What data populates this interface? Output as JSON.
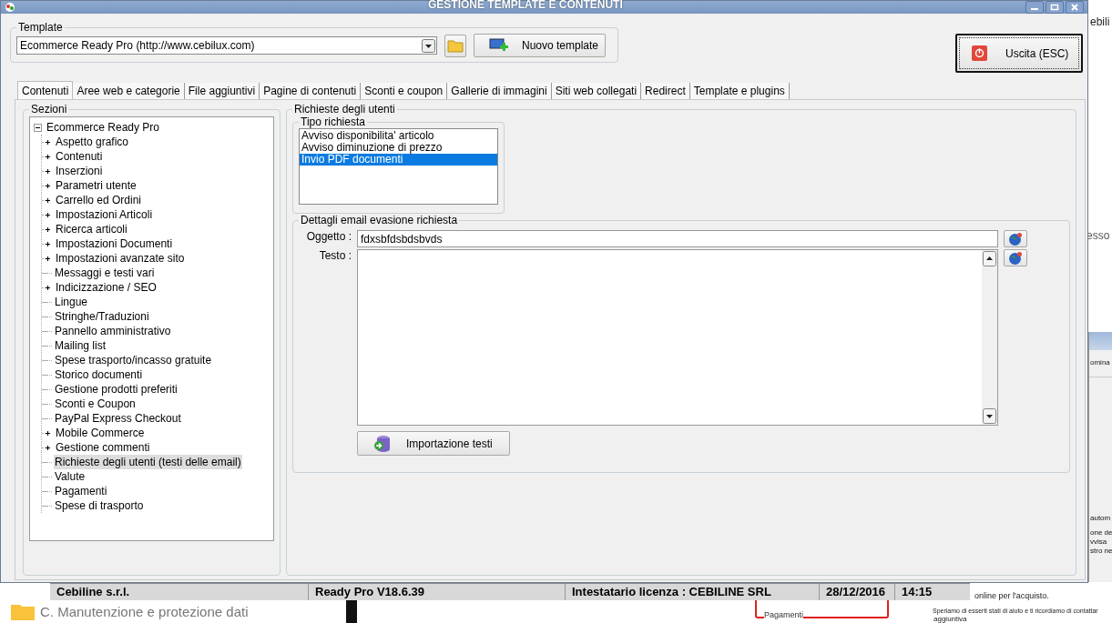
{
  "window": {
    "title": "GESTIONE TEMPLATE E CONTENUTI"
  },
  "template": {
    "label": "Template",
    "value": "Ecommerce Ready Pro (http://www.cebilux.com)",
    "new_button": "Nuovo template"
  },
  "exit_button": "Uscita (ESC)",
  "tabs": [
    {
      "label": "Contenuti",
      "selected": true
    },
    {
      "label": "Aree web e categorie",
      "selected": false
    },
    {
      "label": "File aggiuntivi",
      "selected": false
    },
    {
      "label": "Pagine di contenuti",
      "selected": false
    },
    {
      "label": "Sconti e coupon",
      "selected": false
    },
    {
      "label": "Gallerie di immagini",
      "selected": false
    },
    {
      "label": "Siti web collegati",
      "selected": false
    },
    {
      "label": "Redirect",
      "selected": false
    },
    {
      "label": "Template e plugins",
      "selected": false
    }
  ],
  "sections": {
    "label": "Sezioni",
    "tree": {
      "label": "Ecommerce Ready Pro",
      "expanded": true,
      "selected": false,
      "children": [
        {
          "label": "Aspetto grafico",
          "has_children": true,
          "selected": false
        },
        {
          "label": "Contenuti",
          "has_children": true,
          "selected": false
        },
        {
          "label": "Inserzioni",
          "has_children": true,
          "selected": false
        },
        {
          "label": "Parametri utente",
          "has_children": true,
          "selected": false
        },
        {
          "label": "Carrello ed Ordini",
          "has_children": true,
          "selected": false
        },
        {
          "label": "Impostazioni Articoli",
          "has_children": true,
          "selected": false
        },
        {
          "label": "Ricerca articoli",
          "has_children": true,
          "selected": false
        },
        {
          "label": "Impostazioni Documenti",
          "has_children": true,
          "selected": false
        },
        {
          "label": "Impostazioni avanzate sito",
          "has_children": true,
          "selected": false
        },
        {
          "label": "Messaggi e testi vari",
          "has_children": false,
          "selected": false
        },
        {
          "label": "Indicizzazione / SEO",
          "has_children": true,
          "selected": false
        },
        {
          "label": "Lingue",
          "has_children": false,
          "selected": false
        },
        {
          "label": "Stringhe/Traduzioni",
          "has_children": false,
          "selected": false
        },
        {
          "label": "Pannello amministrativo",
          "has_children": false,
          "selected": false
        },
        {
          "label": "Mailing list",
          "has_children": false,
          "selected": false
        },
        {
          "label": "Spese trasporto/incasso gratuite",
          "has_children": false,
          "selected": false
        },
        {
          "label": "Storico documenti",
          "has_children": false,
          "selected": false
        },
        {
          "label": "Gestione prodotti preferiti",
          "has_children": false,
          "selected": false
        },
        {
          "label": "Sconti e Coupon",
          "has_children": false,
          "selected": false
        },
        {
          "label": "PayPal Express Checkout",
          "has_children": false,
          "selected": false
        },
        {
          "label": "Mobile Commerce",
          "has_children": true,
          "selected": false
        },
        {
          "label": "Gestione commenti",
          "has_children": true,
          "selected": false
        },
        {
          "label": "Richieste degli utenti (testi delle email)",
          "has_children": false,
          "selected": true
        },
        {
          "label": "Valute",
          "has_children": false,
          "selected": false
        },
        {
          "label": "Pagamenti",
          "has_children": false,
          "selected": false
        },
        {
          "label": "Spese di trasporto",
          "has_children": false,
          "selected": false
        }
      ]
    }
  },
  "requests": {
    "label": "Richieste degli utenti",
    "type_group": {
      "label": "Tipo richiesta",
      "items": [
        {
          "label": "Avviso disponibilita' articolo",
          "selected": false
        },
        {
          "label": "Avviso diminuzione di prezzo",
          "selected": false
        },
        {
          "label": "Invio PDF documenti",
          "selected": true
        }
      ]
    },
    "details": {
      "label": "Dettagli email evasione richiesta",
      "subject_label": "Oggetto :",
      "subject": "fdxsbfdsbdsbvds",
      "body_label": "Testo :",
      "import_button": "Importazione testi"
    }
  },
  "background": {
    "right_top_text": "ebili",
    "right_large_text": "esso",
    "right_window": {
      "tab": "omina",
      "lines": [
        "autom",
        "one de",
        "vvisa",
        "stro ne"
      ]
    },
    "status_bar": [
      "Cebiline s.r.l.",
      "Ready Pro V18.6.39",
      "Intestatario licenza : CEBILINE SRL",
      "28/12/2016",
      "14:15"
    ],
    "explorer_item": "C. Manutenzione e protezione dati",
    "inset_item": "Pagamenti",
    "message_lines": [
      "online per l'acquisto.",
      "Speriamo di esserti stati di aiuto e ti ricordiamo di contattar",
      "aggiuntiva"
    ]
  }
}
